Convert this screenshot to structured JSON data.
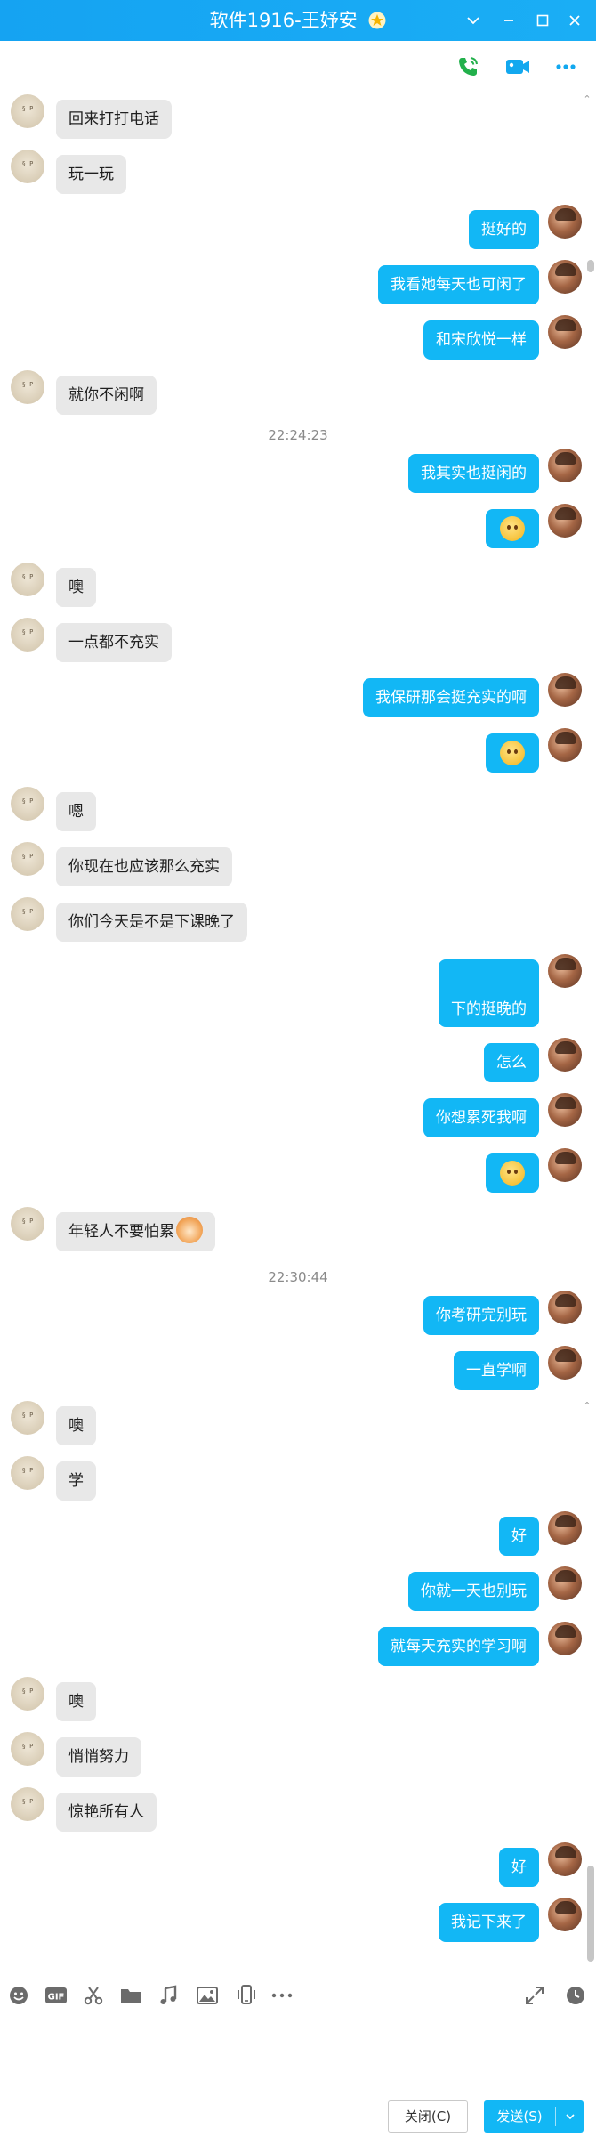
{
  "window": {
    "title": "软件1916-王妤安"
  },
  "timestamps": [
    "22:24:23",
    "22:30:44"
  ],
  "messages": [
    {
      "side": "left",
      "text": "回来打打电话"
    },
    {
      "side": "left",
      "text": "玩一玩"
    },
    {
      "side": "right",
      "text": "挺好的"
    },
    {
      "side": "right",
      "text": "我看她每天也可闲了"
    },
    {
      "side": "right",
      "text": "和宋欣悦一样"
    },
    {
      "side": "left",
      "text": "就你不闲啊"
    },
    {
      "side": "right",
      "text": "我其实也挺闲的"
    },
    {
      "side": "right",
      "emoji": "laughing-tears-emoji"
    },
    {
      "side": "left",
      "text": "噢"
    },
    {
      "side": "left",
      "text": "一点都不充实"
    },
    {
      "side": "right",
      "text": "我保研那会挺充实的啊"
    },
    {
      "side": "right",
      "emoji": "surprised-emoji"
    },
    {
      "side": "left",
      "text": "嗯"
    },
    {
      "side": "left",
      "text": "你现在也应该那么充实"
    },
    {
      "side": "left",
      "text": "你们今天是不是下课晚了"
    },
    {
      "side": "right",
      "text": "下的挺晚的"
    },
    {
      "side": "right",
      "text": "怎么"
    },
    {
      "side": "right",
      "text": "你想累死我啊"
    },
    {
      "side": "right",
      "emoji": "surprised-emoji"
    },
    {
      "side": "left",
      "text": "年轻人不要怕累"
    },
    {
      "side": "right",
      "text": "你考研完别玩"
    },
    {
      "side": "right",
      "text": "一直学啊"
    },
    {
      "side": "left",
      "text": "噢"
    },
    {
      "side": "left",
      "text": "学"
    },
    {
      "side": "right",
      "text": "好"
    },
    {
      "side": "right",
      "text": "你就一天也别玩"
    },
    {
      "side": "right",
      "text": "就每天充实的学习啊"
    },
    {
      "side": "left",
      "text": "噢"
    },
    {
      "side": "left",
      "text": "悄悄努力"
    },
    {
      "side": "left",
      "text": "惊艳所有人"
    },
    {
      "side": "right",
      "text": "好"
    },
    {
      "side": "right",
      "text": "我记下来了"
    }
  ],
  "buttons": {
    "close": "关闭(C)",
    "send": "发送(S)"
  },
  "colors": {
    "titlebar": "#1aaef5",
    "bubble_right": "#12b7f5",
    "bubble_left": "#e8e8e8"
  }
}
